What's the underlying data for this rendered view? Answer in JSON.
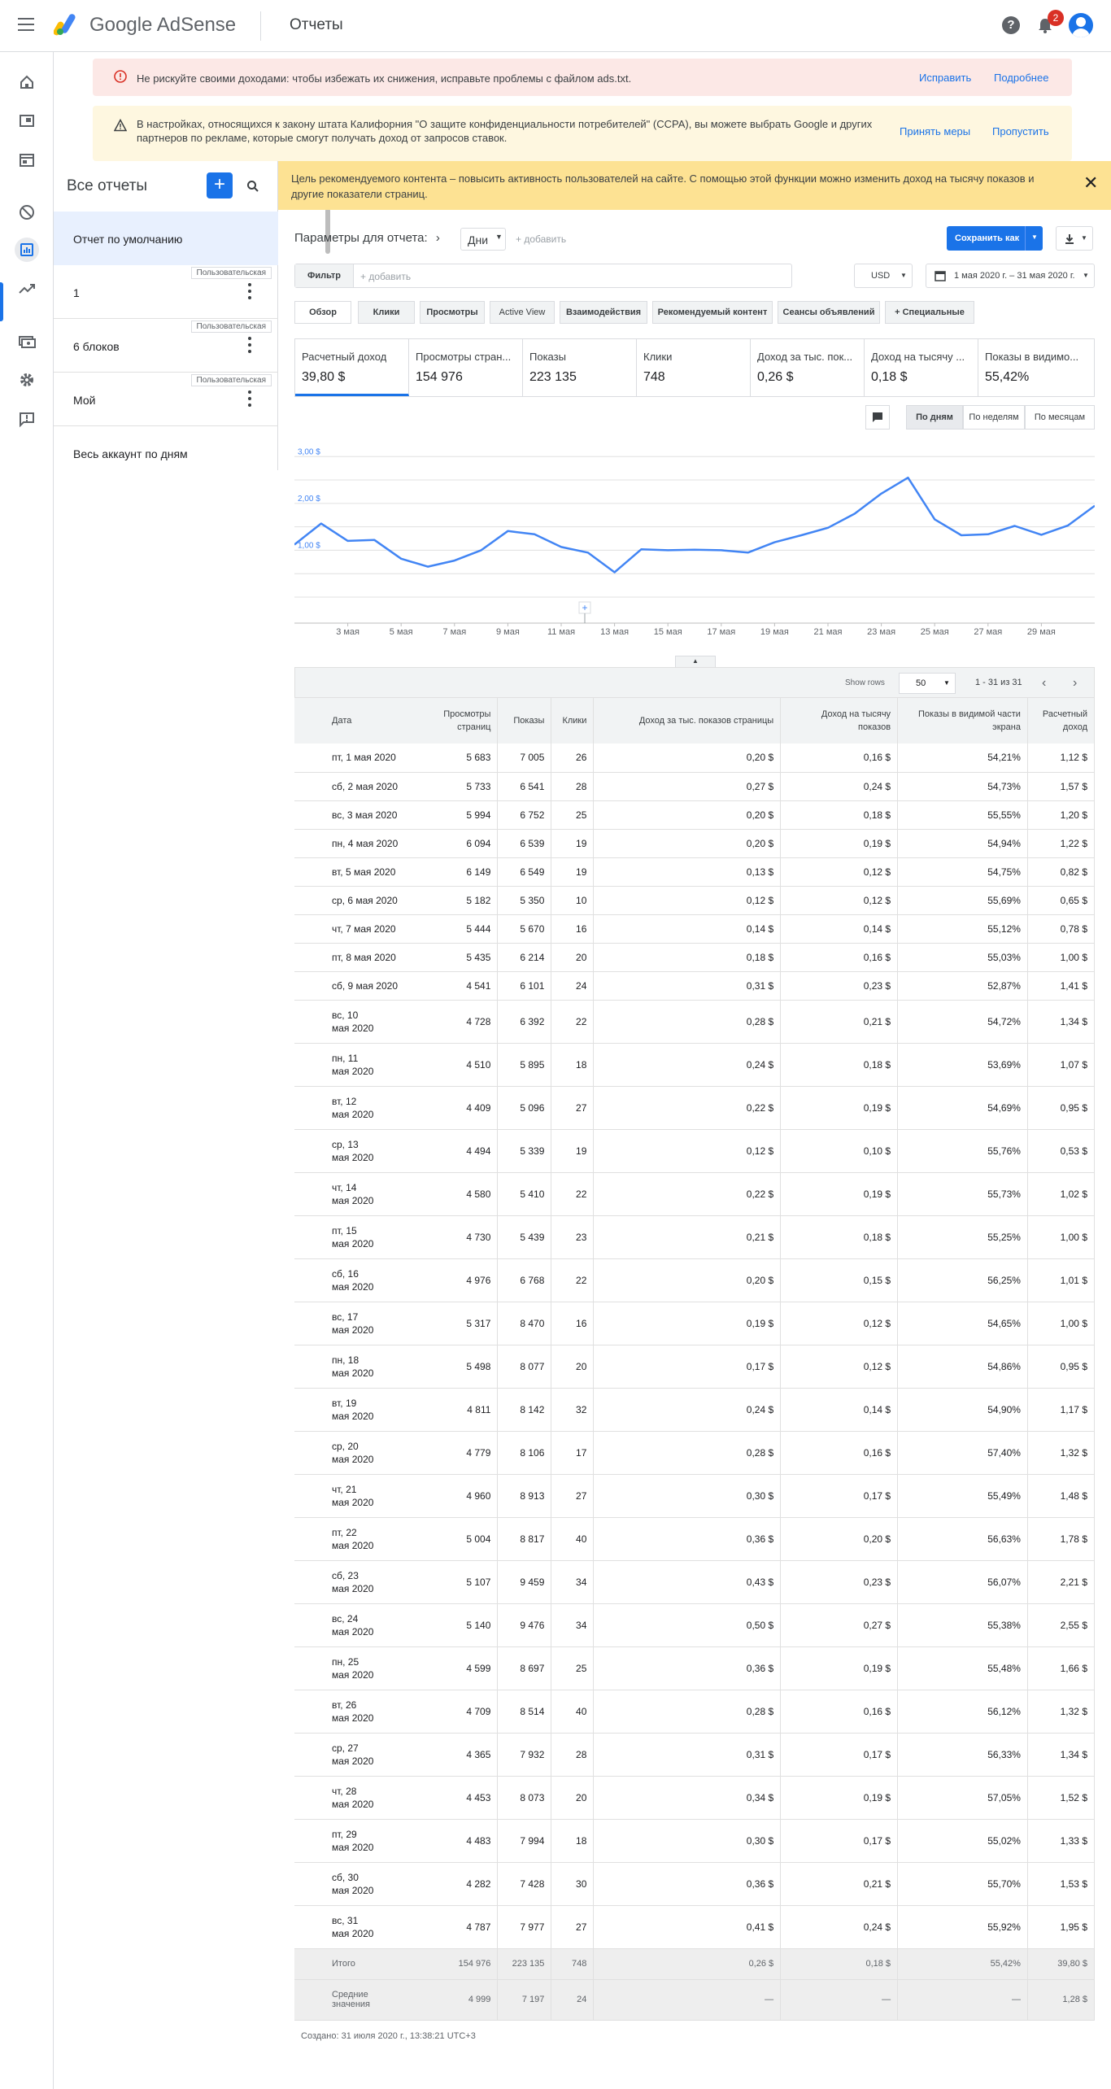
{
  "header": {
    "brand": "Google AdSense",
    "page_title": "Отчеты",
    "notifications_count": "2"
  },
  "nav_rail": {
    "icons": [
      "home-icon",
      "ads-icon",
      "sites-icon",
      "blocking-icon",
      "reports-icon",
      "optimization-icon",
      "payments-icon",
      "settings-icon",
      "feedback-icon"
    ],
    "active": "reports-icon"
  },
  "alerts": [
    {
      "text": "Не рискуйте своими доходами: чтобы избежать их снижения, исправьте проблемы с файлом ads.txt.",
      "actions": [
        "Исправить",
        "Подробнее"
      ]
    },
    {
      "text": "В настройках, относящихся к закону штата Калифорния \"О защите конфиденциальности потребителей\" (CCPA), вы можете выбрать Google и других партнеров по рекламе, которые смогут получать доход от запросов ставок.",
      "actions": [
        "Принять меры",
        "Пропустить"
      ]
    }
  ],
  "reports_panel": {
    "title": "Все отчеты",
    "items": [
      {
        "label": "Отчет по умолчанию",
        "tag": ""
      },
      {
        "label": "1",
        "tag": "Пользовательская"
      },
      {
        "label": "6 блоков",
        "tag": "Пользовательская"
      },
      {
        "label": "Мой",
        "tag": "Пользовательская"
      },
      {
        "label": "Весь аккаунт по дням",
        "tag": ""
      }
    ]
  },
  "banner": {
    "text": "Цель рекомендуемого контента – повысить активность пользователей на сайте. С помощью этой функции можно изменить доход на тысячу показов и другие показатели страниц.",
    "close": "✕"
  },
  "toolbar": {
    "params_label": "Параметры для отчета:",
    "dimension": "Дни",
    "add_dimension": "+ добавить",
    "save_label": "Сохранить как",
    "filter_label": "Фильтр",
    "filter_placeholder": "+ добавить",
    "currency": "USD",
    "date_range": "1 мая 2020 г. – 31 мая 2020 г."
  },
  "tabs": [
    "Обзор",
    "Клики",
    "Просмотры",
    "Active View",
    "Взаимодействия",
    "Рекомендуемый контент",
    "Сеансы объявлений",
    "+  Специальные"
  ],
  "metrics": [
    {
      "label": "Расчетный доход",
      "value": "39,80 $"
    },
    {
      "label": "Просмотры стран...",
      "value": "154 976"
    },
    {
      "label": "Показы",
      "value": "223 135"
    },
    {
      "label": "Клики",
      "value": "748"
    },
    {
      "label": "Доход за тыс. пок...",
      "value": "0,26 $"
    },
    {
      "label": "Доход на тысячу ...",
      "value": "0,18 $"
    },
    {
      "label": "Показы в видимо...",
      "value": "55,42%"
    }
  ],
  "granularity": [
    "По дням",
    "По неделям",
    "По месяцам"
  ],
  "chart_data": {
    "type": "line",
    "series": [
      {
        "values": [
          1.12,
          1.57,
          1.2,
          1.22,
          0.82,
          0.65,
          0.78,
          1.0,
          1.41,
          1.34,
          1.07,
          0.95,
          0.53,
          1.02,
          1.0,
          1.01,
          1.0,
          0.95,
          1.17,
          1.32,
          1.48,
          1.78,
          2.21,
          2.55,
          1.66,
          1.32,
          1.34,
          1.52,
          1.33,
          1.53,
          1.95
        ]
      }
    ],
    "yticks": [
      "1,00 $",
      "2,00 $",
      "3,00 $"
    ],
    "ylim": [
      0,
      3.2
    ],
    "xticks": [
      "3 мая",
      "5 мая",
      "7 мая",
      "9 мая",
      "11 мая",
      "13 мая",
      "15 мая",
      "17 мая",
      "19 мая",
      "21 мая",
      "23 мая",
      "25 мая",
      "27 мая",
      "29 мая"
    ],
    "color": "#4285f4"
  },
  "table": {
    "show_rows_label": "Show rows",
    "rows_per_page": "50",
    "range": "1 - 31 из 31",
    "headers": [
      "Дата",
      "Просмотры страниц",
      "Показы",
      "Клики",
      "Доход за тыс. показов страницы",
      "Доход на тысячу показов",
      "Показы в видимой части экрана",
      "Расчетный доход"
    ],
    "rows": [
      [
        "пт, 1 мая 2020",
        "5 683",
        "7 005",
        "26",
        "0,20 $",
        "0,16 $",
        "54,21%",
        "1,12 $"
      ],
      [
        "сб, 2 мая 2020",
        "5 733",
        "6 541",
        "28",
        "0,27 $",
        "0,24 $",
        "54,73%",
        "1,57 $"
      ],
      [
        "вс, 3 мая 2020",
        "5 994",
        "6 752",
        "25",
        "0,20 $",
        "0,18 $",
        "55,55%",
        "1,20 $"
      ],
      [
        "пн, 4 мая 2020",
        "6 094",
        "6 539",
        "19",
        "0,20 $",
        "0,19 $",
        "54,94%",
        "1,22 $"
      ],
      [
        "вт, 5 мая 2020",
        "6 149",
        "6 549",
        "19",
        "0,13 $",
        "0,12 $",
        "54,75%",
        "0,82 $"
      ],
      [
        "ср, 6 мая 2020",
        "5 182",
        "5 350",
        "10",
        "0,12 $",
        "0,12 $",
        "55,69%",
        "0,65 $"
      ],
      [
        "чт, 7 мая 2020",
        "5 444",
        "5 670",
        "16",
        "0,14 $",
        "0,14 $",
        "55,12%",
        "0,78 $"
      ],
      [
        "пт, 8 мая 2020",
        "5 435",
        "6 214",
        "20",
        "0,18 $",
        "0,16 $",
        "55,03%",
        "1,00 $"
      ],
      [
        "сб, 9 мая 2020",
        "4 541",
        "6 101",
        "24",
        "0,31 $",
        "0,23 $",
        "52,87%",
        "1,41 $"
      ],
      [
        "вс, 10 мая 2020",
        "4 728",
        "6 392",
        "22",
        "0,28 $",
        "0,21 $",
        "54,72%",
        "1,34 $"
      ],
      [
        "пн, 11 мая 2020",
        "4 510",
        "5 895",
        "18",
        "0,24 $",
        "0,18 $",
        "53,69%",
        "1,07 $"
      ],
      [
        "вт, 12 мая 2020",
        "4 409",
        "5 096",
        "27",
        "0,22 $",
        "0,19 $",
        "54,69%",
        "0,95 $"
      ],
      [
        "ср, 13 мая 2020",
        "4 494",
        "5 339",
        "19",
        "0,12 $",
        "0,10 $",
        "55,76%",
        "0,53 $"
      ],
      [
        "чт, 14 мая 2020",
        "4 580",
        "5 410",
        "22",
        "0,22 $",
        "0,19 $",
        "55,73%",
        "1,02 $"
      ],
      [
        "пт, 15 мая 2020",
        "4 730",
        "5 439",
        "23",
        "0,21 $",
        "0,18 $",
        "55,25%",
        "1,00 $"
      ],
      [
        "сб, 16 мая 2020",
        "4 976",
        "6 768",
        "22",
        "0,20 $",
        "0,15 $",
        "56,25%",
        "1,01 $"
      ],
      [
        "вс, 17 мая 2020",
        "5 317",
        "8 470",
        "16",
        "0,19 $",
        "0,12 $",
        "54,65%",
        "1,00 $"
      ],
      [
        "пн, 18 мая 2020",
        "5 498",
        "8 077",
        "20",
        "0,17 $",
        "0,12 $",
        "54,86%",
        "0,95 $"
      ],
      [
        "вт, 19 мая 2020",
        "4 811",
        "8 142",
        "32",
        "0,24 $",
        "0,14 $",
        "54,90%",
        "1,17 $"
      ],
      [
        "ср, 20 мая 2020",
        "4 779",
        "8 106",
        "17",
        "0,28 $",
        "0,16 $",
        "57,40%",
        "1,32 $"
      ],
      [
        "чт, 21 мая 2020",
        "4 960",
        "8 913",
        "27",
        "0,30 $",
        "0,17 $",
        "55,49%",
        "1,48 $"
      ],
      [
        "пт, 22 мая 2020",
        "5 004",
        "8 817",
        "40",
        "0,36 $",
        "0,20 $",
        "56,63%",
        "1,78 $"
      ],
      [
        "сб, 23 мая 2020",
        "5 107",
        "9 459",
        "34",
        "0,43 $",
        "0,23 $",
        "56,07%",
        "2,21 $"
      ],
      [
        "вс, 24 мая 2020",
        "5 140",
        "9 476",
        "34",
        "0,50 $",
        "0,27 $",
        "55,38%",
        "2,55 $"
      ],
      [
        "пн, 25 мая 2020",
        "4 599",
        "8 697",
        "25",
        "0,36 $",
        "0,19 $",
        "55,48%",
        "1,66 $"
      ],
      [
        "вт, 26 мая 2020",
        "4 709",
        "8 514",
        "40",
        "0,28 $",
        "0,16 $",
        "56,12%",
        "1,32 $"
      ],
      [
        "ср, 27 мая 2020",
        "4 365",
        "7 932",
        "28",
        "0,31 $",
        "0,17 $",
        "56,33%",
        "1,34 $"
      ],
      [
        "чт, 28 мая 2020",
        "4 453",
        "8 073",
        "20",
        "0,34 $",
        "0,19 $",
        "57,05%",
        "1,52 $"
      ],
      [
        "пт, 29 мая 2020",
        "4 483",
        "7 994",
        "18",
        "0,30 $",
        "0,17 $",
        "55,02%",
        "1,33 $"
      ],
      [
        "сб, 30 мая 2020",
        "4 282",
        "7 428",
        "30",
        "0,36 $",
        "0,21 $",
        "55,70%",
        "1,53 $"
      ],
      [
        "вс, 31 мая 2020",
        "4 787",
        "7 977",
        "27",
        "0,41 $",
        "0,24 $",
        "55,92%",
        "1,95 $"
      ]
    ],
    "total": [
      "Итого",
      "154 976",
      "223 135",
      "748",
      "0,26 $",
      "0,18 $",
      "55,42%",
      "39,80 $"
    ],
    "average": [
      "Средние значения",
      "4 999",
      "7 197",
      "24",
      "—",
      "—",
      "—",
      "1,28 $"
    ]
  },
  "footer": {
    "created": "Создано: 31 июля 2020 г., 13:38:21 UTC+3"
  }
}
